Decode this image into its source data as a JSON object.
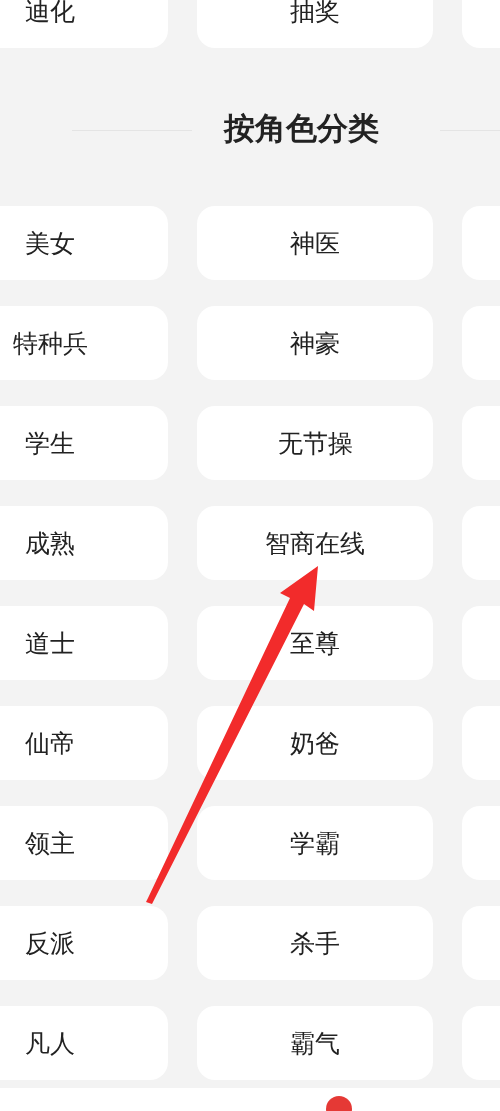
{
  "top_row": [
    "迪化",
    "抽奖"
  ],
  "section": {
    "title": "按角色分类"
  },
  "rows": [
    [
      "美女",
      "神医"
    ],
    [
      "特种兵",
      "神豪"
    ],
    [
      "学生",
      "无节操"
    ],
    [
      "成熟",
      "智商在线"
    ],
    [
      "道士",
      "至尊"
    ],
    [
      "仙帝",
      "奶爸"
    ],
    [
      "领主",
      "学霸"
    ],
    [
      "反派",
      "杀手"
    ],
    [
      "凡人",
      "霸气"
    ]
  ]
}
